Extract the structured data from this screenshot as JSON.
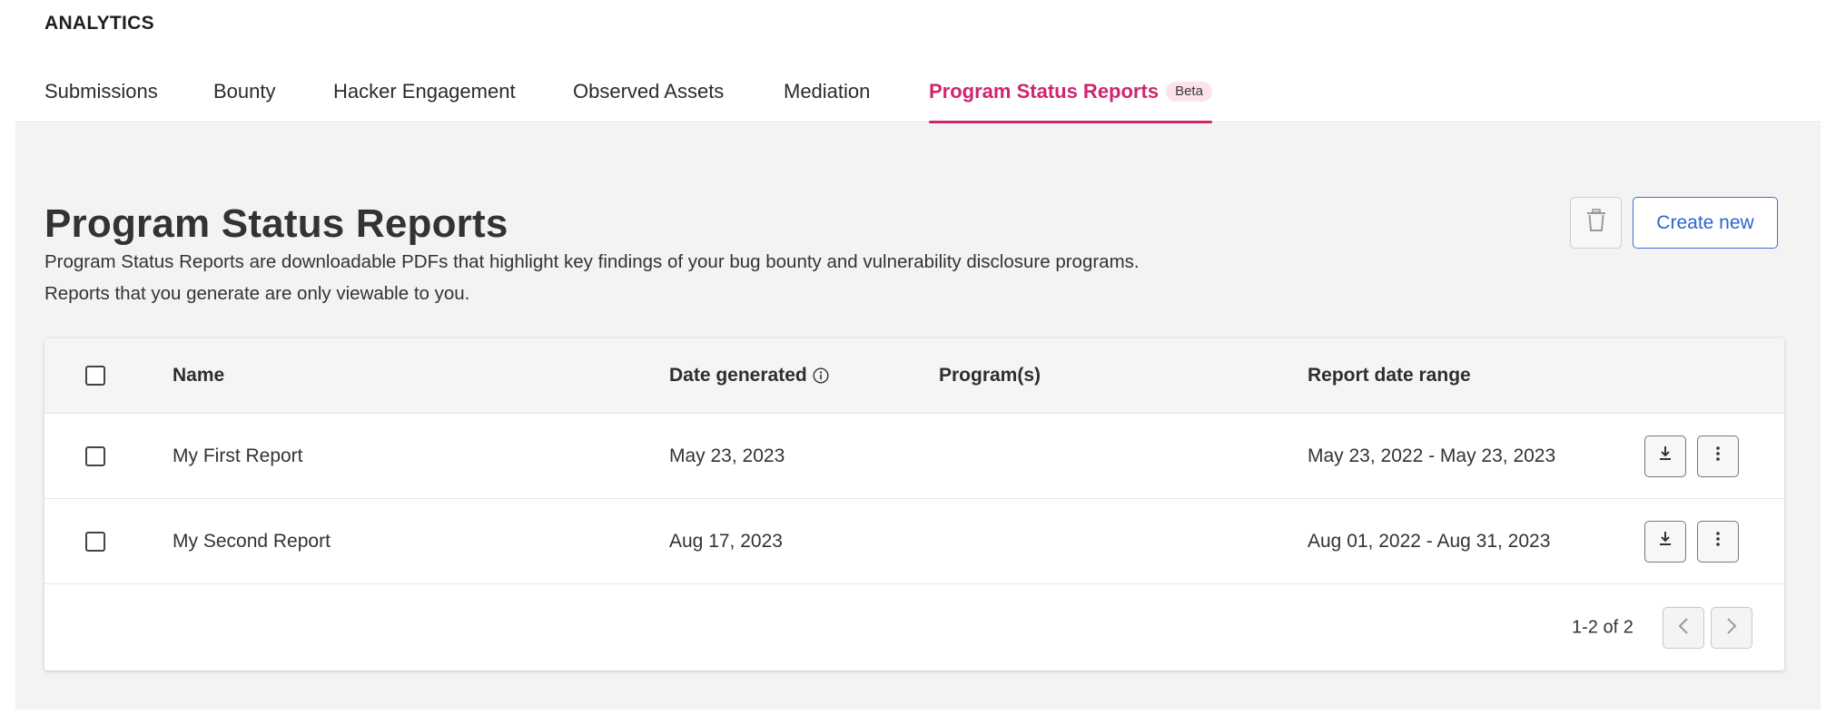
{
  "header": {
    "title": "ANALYTICS"
  },
  "tabs": [
    {
      "label": "Submissions"
    },
    {
      "label": "Bounty"
    },
    {
      "label": "Hacker Engagement"
    },
    {
      "label": "Observed Assets"
    },
    {
      "label": "Mediation"
    },
    {
      "label": "Program Status Reports",
      "badge": "Beta",
      "active": true
    }
  ],
  "page": {
    "title": "Program Status Reports",
    "description_line1": "Program Status Reports are downloadable PDFs that highlight key findings of your bug bounty and vulnerability disclosure programs.",
    "description_line2": "Reports that you generate are only viewable to you.",
    "create_label": "Create new"
  },
  "table": {
    "columns": {
      "name": "Name",
      "date_generated": "Date generated",
      "programs": "Program(s)",
      "report_date_range": "Report date range"
    },
    "rows": [
      {
        "name": "My First Report",
        "date_generated": "May 23, 2023",
        "programs": "",
        "report_date_range": "May 23, 2022 - May 23, 2023"
      },
      {
        "name": "My Second Report",
        "date_generated": "Aug 17, 2023",
        "programs": "",
        "report_date_range": "Aug 01, 2022 - Aug 31, 2023"
      }
    ],
    "pagination": {
      "label": "1-2 of 2"
    }
  },
  "icons": {
    "trash": "trash-icon",
    "info": "info-icon",
    "download": "download-icon",
    "more": "more-vertical-icon",
    "prev": "chevron-left-icon",
    "next": "chevron-right-icon"
  },
  "colors": {
    "accent": "#d1246f",
    "badge_bg": "#fbe2ec",
    "primary_button": "#2f63cf",
    "content_bg": "#f3f3f3",
    "table_header_bg": "#f4f5f7"
  }
}
